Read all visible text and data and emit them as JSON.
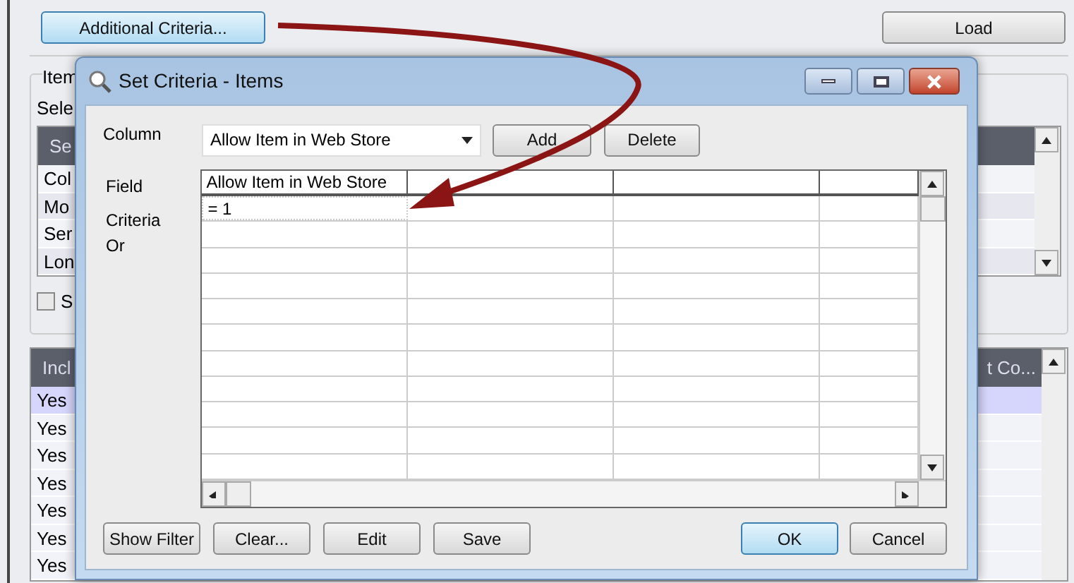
{
  "toolbar": {
    "criteria_button": "Additional Criteria...",
    "load_button": "Load"
  },
  "item_group": {
    "title": "Item",
    "caption": "Sele",
    "list_header": "Se",
    "rows": [
      "Col",
      "Mo",
      "Ser",
      "Lon"
    ],
    "checkbox": {
      "label": "S",
      "checked": false
    }
  },
  "results": {
    "header": "Incl",
    "header_right": "t Co...",
    "rows": [
      {
        "include": "Yes",
        "selected": true
      },
      {
        "include": "Yes",
        "selected": false
      },
      {
        "include": "Yes",
        "selected": false
      },
      {
        "include": "Yes",
        "selected": false
      },
      {
        "include": "Yes",
        "selected": false
      },
      {
        "include": "Yes",
        "selected": false
      },
      {
        "include": "Yes",
        "selected": false
      }
    ]
  },
  "dialog": {
    "title": "Set Criteria - Items",
    "column_label": "Column",
    "column_value": "Allow Item in Web Store",
    "add_button": "Add",
    "delete_button": "Delete",
    "row_labels": [
      "Field",
      "Criteria",
      "Or"
    ],
    "grid": {
      "columns": [
        "Allow Item in Web Store"
      ],
      "rows": [
        {
          "cells": [
            "= 1"
          ]
        }
      ]
    },
    "buttons_left": [
      "Show Filter",
      "Clear...",
      "Edit",
      "Save"
    ],
    "buttons_right": [
      {
        "label": "OK",
        "default": true
      },
      {
        "label": "Cancel",
        "default": false
      }
    ]
  }
}
